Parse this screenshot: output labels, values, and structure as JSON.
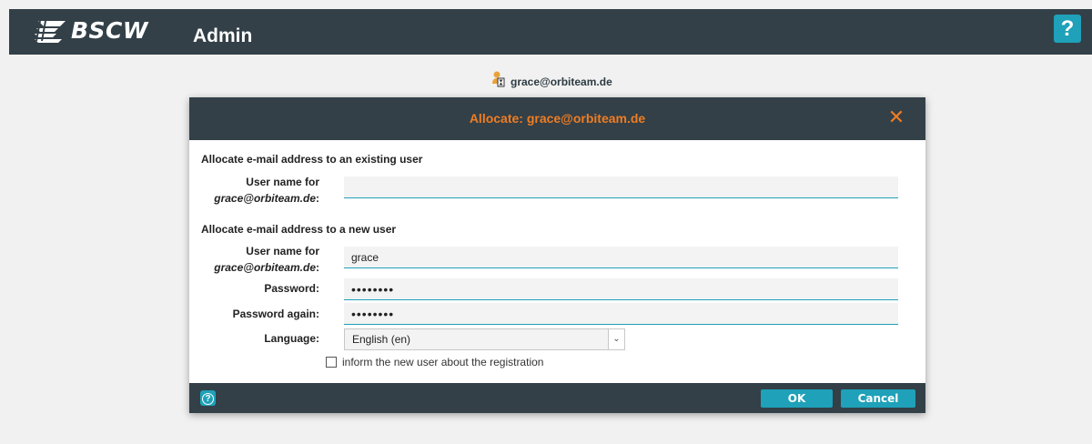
{
  "header": {
    "logo_text": "BSCW",
    "title": "Admin",
    "help_label": "?",
    "colors": {
      "bar": "#334048",
      "accent": "#1ea1b9",
      "orange": "#ef7d22"
    }
  },
  "user_line": {
    "icon": "user-clock-icon",
    "email": "grace@orbiteam.de"
  },
  "dialog": {
    "title": "Allocate: grace@orbiteam.de",
    "close_label": "✕",
    "existing_section": {
      "title": "Allocate e-mail address to an existing user",
      "username_label_line1": "User name for",
      "username_label_email": "grace@orbiteam.de",
      "username_label_suffix": ":",
      "username_value": ""
    },
    "new_section": {
      "title": "Allocate e-mail address to a new user",
      "username_label_line1": "User name for",
      "username_label_email": "grace@orbiteam.de",
      "username_label_suffix": ":",
      "username_value": "grace",
      "password_label": "Password:",
      "password_value": "••••••••",
      "password_again_label": "Password again:",
      "password_again_value": "••••••••",
      "language_label": "Language:",
      "language_value": "English (en)",
      "inform_label": "inform the new user about the registration",
      "inform_checked": false
    },
    "footer": {
      "help_label": "?",
      "ok_label": "OK",
      "cancel_label": "Cancel"
    }
  }
}
